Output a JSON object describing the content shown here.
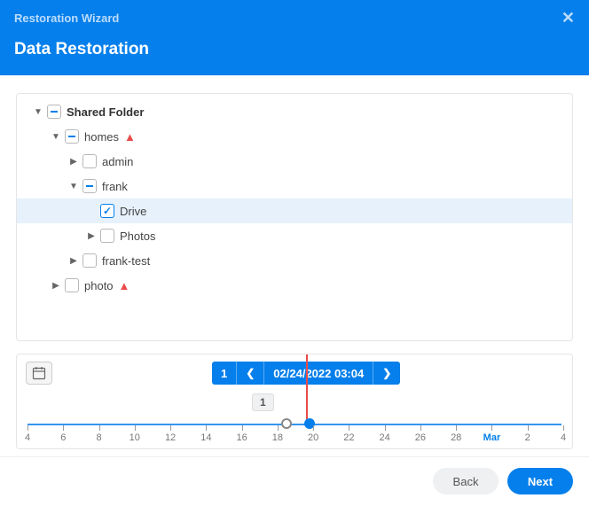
{
  "window": {
    "title": "Restoration Wizard"
  },
  "page": {
    "title": "Data Restoration"
  },
  "tree": {
    "root": "Shared Folder",
    "homes": "homes",
    "admin": "admin",
    "frank": "frank",
    "drive": "Drive",
    "photos": "Photos",
    "frank_test": "frank-test",
    "photo": "photo"
  },
  "timeline": {
    "version_count": "1",
    "selected_label": "02/24/2022 03:04",
    "badge": "1",
    "ticks": [
      "4",
      "6",
      "8",
      "10",
      "12",
      "14",
      "16",
      "18",
      "20",
      "22",
      "24",
      "26",
      "28",
      "Mar",
      "2",
      "4"
    ],
    "month_index": 13
  },
  "footer": {
    "back": "Back",
    "next": "Next"
  }
}
